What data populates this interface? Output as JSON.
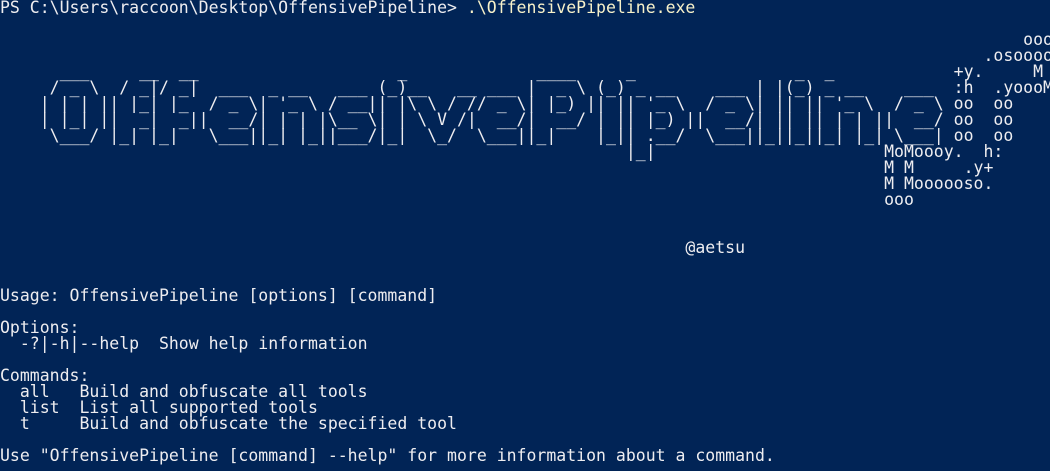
{
  "prompt": {
    "text": "PS C:\\Users\\raccoon\\Desktop\\OffensivePipeline> ",
    "command": ".\\OffensivePipeline.exe"
  },
  "banner": "                                                                                                       ooo\n                                                                                                   .osooooM M\n      ___     __  __                    _             ____     _                _  _            +y.     M M\n     / _ \\  / _|/ _|  ___  _ __   ___ (_)__   __ ___ |  _ \\ (_) _ __    ___ | |(_) _ __    ___  :h  .yoooMoM\n    | | | || |_| |_  / _ \\| '_ \\ / __|| |\\ \\ / // _ \\| |_) || || '_ \\  / _ \\| || || '_ \\  / _ \\ oo  oo\n    | |_| ||  _|  _||  __/| | | |\\__ \\| | \\ V /|  __/|  __/ | || |_) ||  __/| || || | | ||  __/ oo  oo\n     \\___/ |_| |_|   \\___||_| |_||___/|_|  \\_/  \\___||_|    |_|| .__/  \\___||_||_||_| |_| \\___| oo  oo\n                                                               |_|                       MoMoooy.  h:\n                                                                                         M M     .y+\n                                                                                         M Moooooso.\n                                                                                         ooo\n\n\n                                                                     @aetsu",
  "usage": "Usage: OffensivePipeline [options] [command]",
  "options": {
    "heading": "Options:",
    "items": [
      "  -?|-h|--help  Show help information"
    ]
  },
  "commands": {
    "heading": "Commands:",
    "items": [
      "  all   Build and obfuscate all tools",
      "  list  List all supported tools",
      "  t     Build and obfuscate the specified tool"
    ]
  },
  "footer": "Use \"OffensivePipeline [command] --help\" for more information about a command.",
  "colors": {
    "background": "#012456",
    "text": "#eeedf0",
    "command": "#f7f1c9"
  }
}
